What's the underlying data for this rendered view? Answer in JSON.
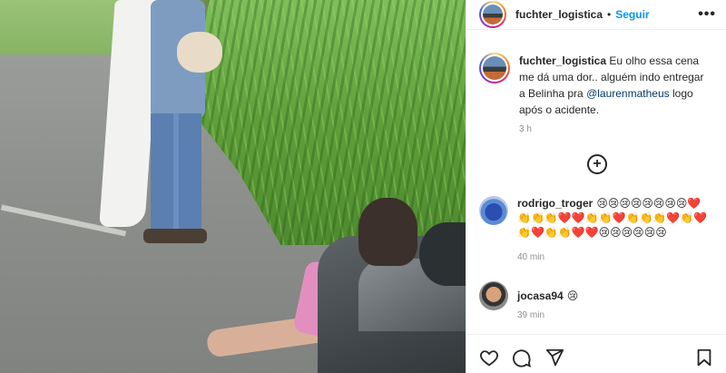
{
  "post": {
    "username": "fuchter_logistica",
    "separator": "•",
    "follow_label": "Seguir",
    "more_label": "•••"
  },
  "caption": {
    "username": "fuchter_logistica",
    "text_before": " Eu olho essa cena me dá uma dor.. alguém indo entregar a Belinha pra ",
    "mention": "@laurenmatheus",
    "text_after": " logo após o acidente.",
    "time": "3 h"
  },
  "load_more_label": "+",
  "comments": [
    {
      "username": "rodrigo_troger",
      "text": "😢😢😢😢😢😢😢😢❤️👏👏👏❤️❤️👏👏❤️👏👏👏❤️👏❤️👏❤️👏👏❤️❤️😢😢😢😢😢😢",
      "time": "40 min"
    },
    {
      "username": "jocasa94",
      "text": "😢",
      "time": "39 min"
    }
  ],
  "icons": [
    "heart-icon",
    "comment-icon",
    "share-icon",
    "bookmark-icon",
    "plus-circle-icon",
    "more-icon"
  ],
  "colors": {
    "accent": "#0095f6",
    "text": "#262626",
    "muted": "#8e8e8e",
    "mention": "#00376b"
  }
}
